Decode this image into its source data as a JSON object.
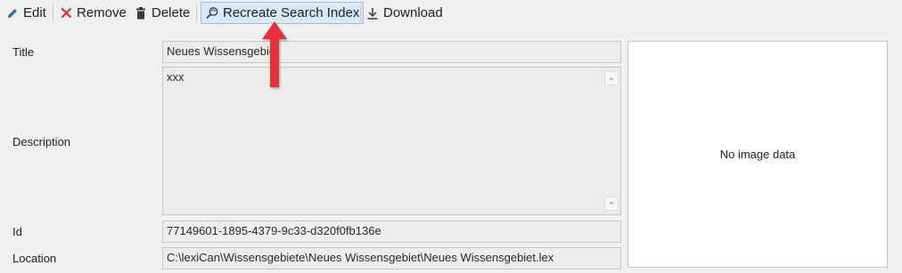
{
  "toolbar": {
    "edit_label": "Edit",
    "remove_label": "Remove",
    "delete_label": "Delete",
    "recreate_label": "Recreate Search Index",
    "download_label": "Download"
  },
  "form": {
    "title_label": "Title",
    "title_value": "Neues Wissensgebiet",
    "description_label": "Description",
    "description_value": "xxx",
    "id_label": "Id",
    "id_value": "77149601-1895-4379-9c33-d320f0fb136e",
    "location_label": "Location",
    "location_value": "C:\\lexiCan\\Wissensgebiete\\Neues Wissensgebiet\\Neues Wissensgebiet.lex"
  },
  "image_panel": {
    "placeholder": "No image data"
  },
  "icons": {
    "edit": "pencil-icon",
    "remove": "x-icon",
    "delete": "trash-icon",
    "recreate": "search-refresh-icon",
    "download": "download-icon"
  },
  "colors": {
    "accent_blue": "#2f6fc0",
    "remove_red": "#d9342b",
    "annotation_red": "#e8313b",
    "highlight_bg": "#d9e8fb"
  }
}
